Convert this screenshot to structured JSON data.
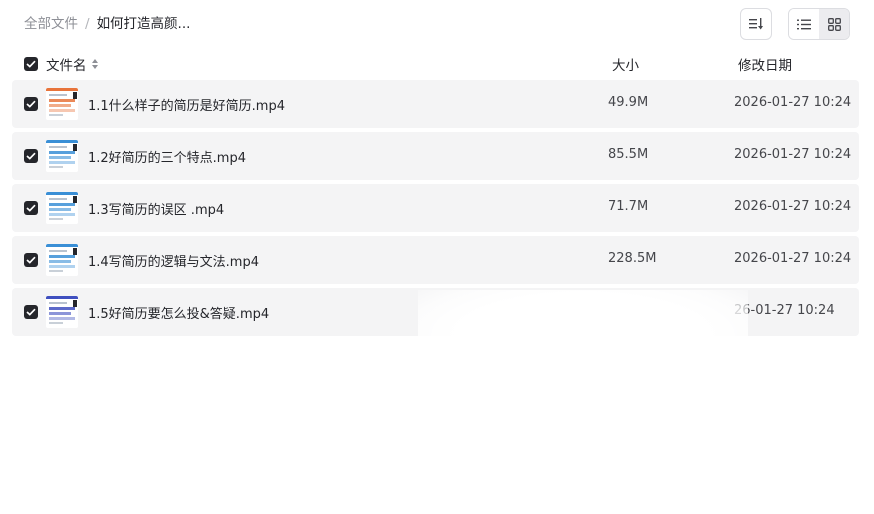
{
  "breadcrumb": {
    "root": "全部文件",
    "separator": "/",
    "current": "如何打造高颜..."
  },
  "toolbar": {
    "sort_icon": "sort-icon",
    "list_view_icon": "list-view-icon",
    "grid_view_icon": "grid-view-icon"
  },
  "table": {
    "headers": {
      "name": "文件名",
      "size": "大小",
      "date": "修改日期"
    },
    "rows": [
      {
        "name": "1.1什么样子的简历是好简历.mp4",
        "size": "49.9M",
        "date": "2026-01-27 10:24",
        "checked": true,
        "thumb_accent": "#e8743b"
      },
      {
        "name": "1.2好简历的三个特点.mp4",
        "size": "85.5M",
        "date": "2026-01-27 10:24",
        "checked": true,
        "thumb_accent": "#3a8fd6"
      },
      {
        "name": "1.3写简历的误区 .mp4",
        "size": "71.7M",
        "date": "2026-01-27 10:24",
        "checked": true,
        "thumb_accent": "#3a8fd6"
      },
      {
        "name": "1.4写简历的逻辑与文法.mp4",
        "size": "228.5M",
        "date": "2026-01-27 10:24",
        "checked": true,
        "thumb_accent": "#3a8fd6"
      },
      {
        "name": "1.5好简历要怎么投&答疑.mp4",
        "size": "",
        "date": "26-01-27 10:24",
        "checked": true,
        "thumb_accent": "#3f4fbf"
      }
    ]
  },
  "colors": {
    "row_bg": "#f4f4f5",
    "checkbox": "#25262b",
    "muted_text": "#8d8f96"
  }
}
